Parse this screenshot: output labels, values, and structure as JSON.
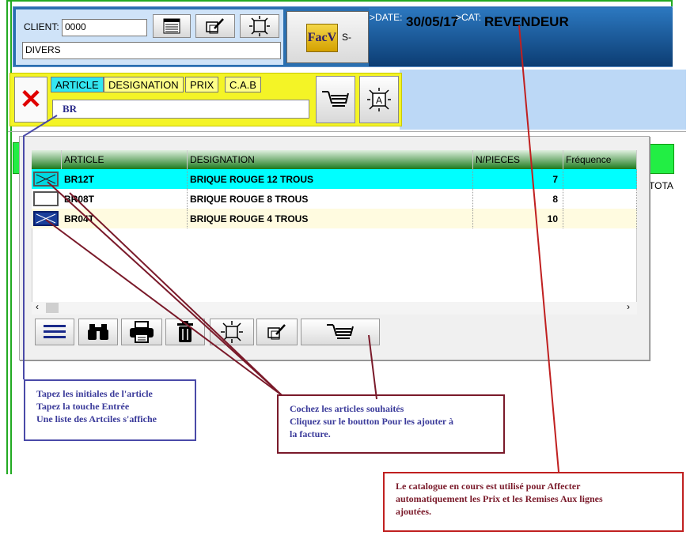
{
  "header": {
    "client_label": "CLIENT:",
    "client_code": "0000",
    "client_name": "DIVERS",
    "facv_label": "FacV",
    "facv_suffix": "S-",
    "date_prefix": ">DATE:",
    "date_value": "30/05/17",
    "cat_prefix": ">CAT:",
    "cat_value": "REVENDEUR"
  },
  "search": {
    "tabs": [
      "ARTICLE",
      "DESIGNATION",
      "PRIX",
      "C.A.B"
    ],
    "value": "BR"
  },
  "background": {
    "total_label": "TOTA"
  },
  "table": {
    "columns": [
      "ARTICLE",
      "DESIGNATION",
      "N/PIECES",
      "Fréquence"
    ],
    "rows": [
      {
        "checked": true,
        "article": "BR12T",
        "designation": "BRIQUE ROUGE 12 TROUS",
        "pieces": "7",
        "frequence": ""
      },
      {
        "checked": false,
        "article": "BR08T",
        "designation": "BRIQUE ROUGE 8 TROUS",
        "pieces": "8",
        "frequence": ""
      },
      {
        "checked": true,
        "article": "BR04T",
        "designation": "BRIQUE ROUGE 4 TROUS",
        "pieces": "10",
        "frequence": ""
      }
    ]
  },
  "scroll": {
    "left": "‹",
    "right": "›"
  },
  "toolbar_icons": [
    "menu-icon",
    "binoculars-icon",
    "printer-icon",
    "trash-icon",
    "select-icon",
    "edit-icon",
    "cart-icon"
  ],
  "notes": {
    "note1": [
      "Tapez les initiales de l'article",
      "Tapez la touche Entrée",
      "Une liste des Artciles s'affiche"
    ],
    "note2": [
      "Cochez les articles souhaités",
      "Cliquez sur le boutton Pour les ajouter à",
      "la facture."
    ],
    "note3": [
      "Le catalogue en cours est utilisé pour Affecter",
      "automatiquement les Prix et  les Remises Aux lignes",
      "ajoutées."
    ]
  },
  "colors": {
    "header_blue": "#2a6fb0",
    "search_yellow": "#f4f426",
    "tab_selected": "#33e6f0",
    "row_selected": "#00ffff",
    "row_alt": "#fffbe0",
    "grid_header_green": "#1c7a1c",
    "annotation_red": "#c02020",
    "annotation_maroon": "#7a1a2a",
    "annotation_blue": "#4a4aa8"
  }
}
